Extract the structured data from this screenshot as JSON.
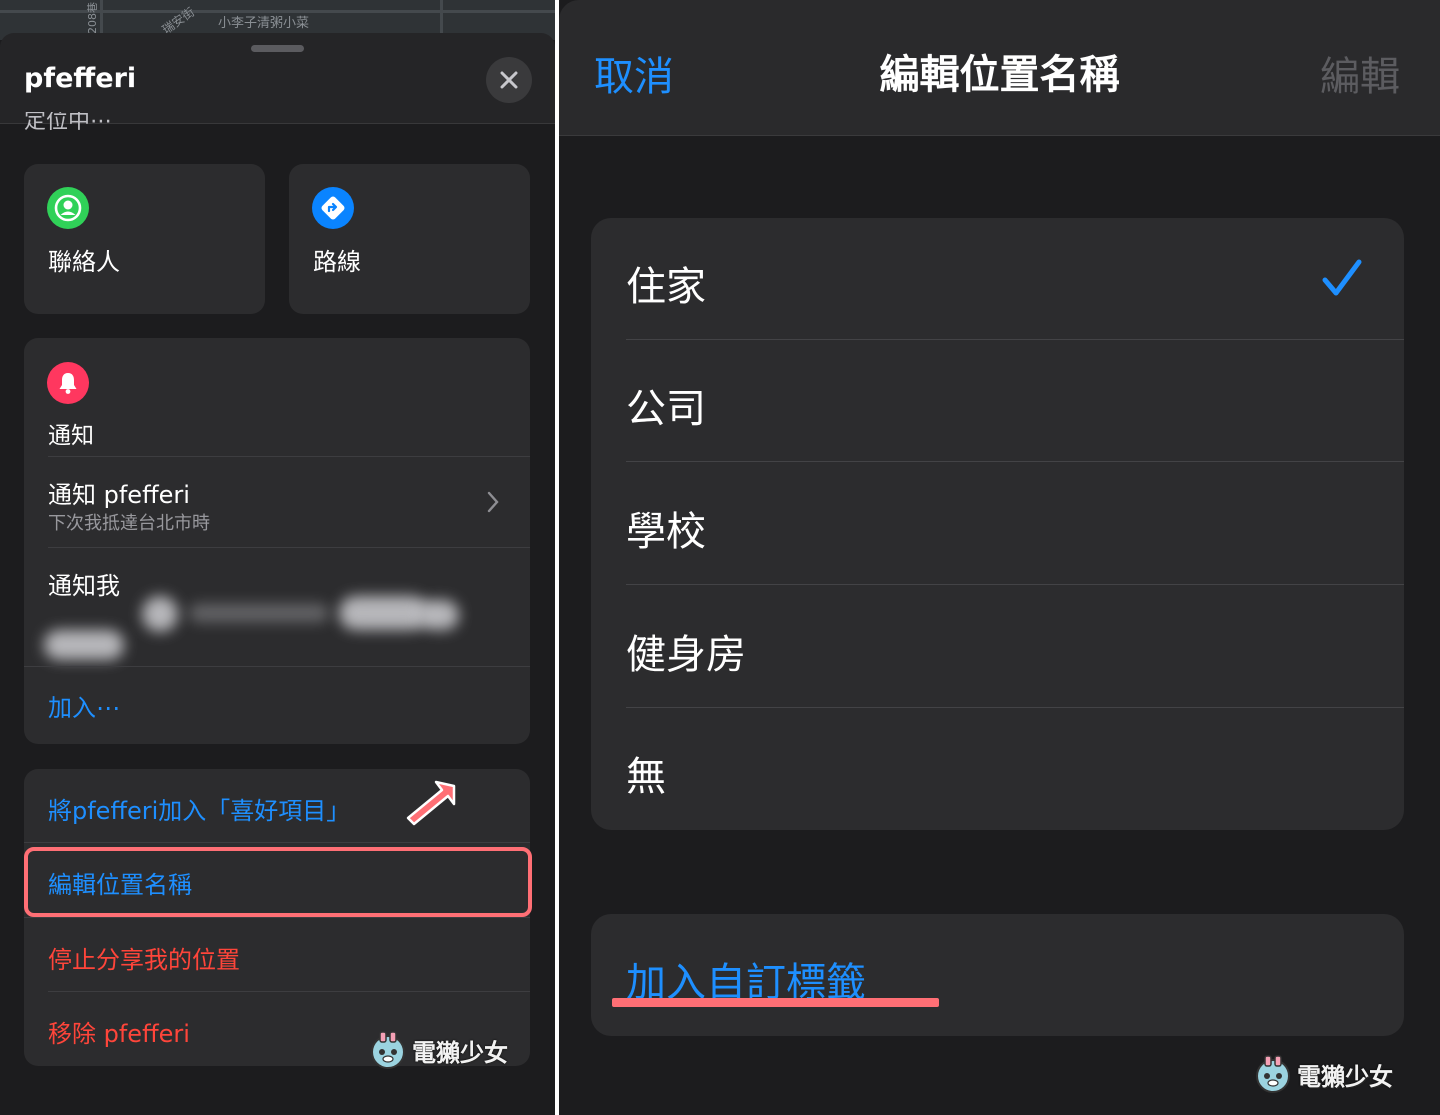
{
  "left": {
    "map": {
      "streets": [
        "208巷",
        "瑞安街",
        "小李子清粥小菜"
      ]
    },
    "header": {
      "title": "pfefferi",
      "status_peek": "定位中⋯"
    },
    "actions": [
      {
        "label": "聯絡人",
        "icon": "person-circle-icon",
        "color": "#30d158"
      },
      {
        "label": "路線",
        "icon": "directions-arrow-icon",
        "color": "#0a84ff"
      }
    ],
    "notifications": {
      "section_title": "通知",
      "icon_color": "#ff375f",
      "notify_friend_title": "通知 pfefferi",
      "notify_friend_subtitle": "下次我抵達台北市時",
      "notify_me_title": "通知我",
      "add_label": "加入⋯"
    },
    "menu": {
      "add_favorite": "將pfefferi加入「喜好項目」",
      "edit_location_name": "編輯位置名稱",
      "stop_sharing": "停止分享我的位置",
      "remove": "移除 pfefferi"
    },
    "watermark": "電獺少女"
  },
  "right": {
    "nav": {
      "cancel": "取消",
      "title": "編輯位置名稱",
      "edit": "編輯"
    },
    "options": [
      {
        "label": "住家",
        "selected": true
      },
      {
        "label": "公司",
        "selected": false
      },
      {
        "label": "學校",
        "selected": false
      },
      {
        "label": "健身房",
        "selected": false
      },
      {
        "label": "無",
        "selected": false
      }
    ],
    "add_custom_label": "加入自訂標籤",
    "watermark": "電獺少女"
  },
  "colors": {
    "accent_blue": "#1e8fff",
    "destructive_red": "#ff453a",
    "annotation_pink": "#ff6f75"
  }
}
